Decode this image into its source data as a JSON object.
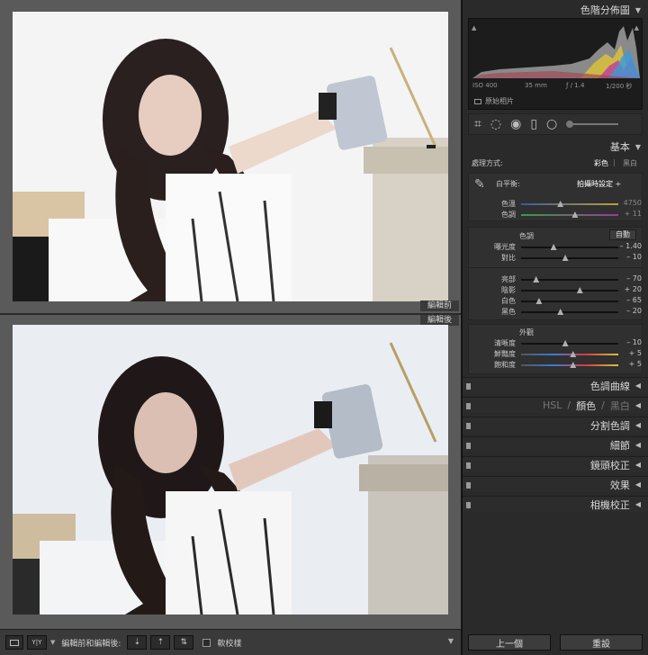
{
  "compare": {
    "before_label": "編輯前",
    "after_label": "編輯後"
  },
  "toolbar": {
    "compare_mode_label": "編輯前和編輯後:",
    "soft_proof_label": "軟校樣",
    "view_icon_label": "Y|Y"
  },
  "histogram": {
    "title": "色階分佈圖",
    "iso": "ISO 400",
    "focal": "35 mm",
    "aperture": "ƒ / 1.4",
    "shutter": "1/200 秒",
    "original_photo_label": "原始相片"
  },
  "basic": {
    "title": "基本",
    "treatment_label": "處理方式:",
    "treatment_color": "彩色",
    "treatment_bw": "黑白",
    "wb_label": "白平衡:",
    "wb_value": "拍攝時設定 ÷",
    "temp": {
      "label": "色溫",
      "value": "4750",
      "pos": 0.4
    },
    "tint": {
      "label": "色調",
      "value": "+ 11",
      "pos": 0.55
    },
    "tone_title": "色調",
    "auto_label": "自動",
    "exposure": {
      "label": "曝光度",
      "value": "– 1.40",
      "pos": 0.33
    },
    "contrast": {
      "label": "對比",
      "value": "– 10",
      "pos": 0.45
    },
    "highlights": {
      "label": "亮部",
      "value": "– 70",
      "pos": 0.15
    },
    "shadows": {
      "label": "陰影",
      "value": "+ 20",
      "pos": 0.6
    },
    "whites": {
      "label": "白色",
      "value": "– 65",
      "pos": 0.18
    },
    "blacks": {
      "label": "黑色",
      "value": "– 20",
      "pos": 0.4
    },
    "presence_title": "外觀",
    "clarity": {
      "label": "清晰度",
      "value": "– 10",
      "pos": 0.45
    },
    "vibrance": {
      "label": "鮮豔度",
      "value": "+ 5",
      "pos": 0.53
    },
    "saturation": {
      "label": "飽和度",
      "value": "+ 5",
      "pos": 0.53
    }
  },
  "panels": {
    "tone_curve": "色調曲線",
    "hsl": "HSL",
    "hsl_color": "顏色",
    "hsl_bw": "黑白",
    "sep": "/",
    "split_toning": "分割色調",
    "detail": "細節",
    "lens": "鏡頭校正",
    "effects": "效果",
    "camera": "相機校正"
  },
  "nav": {
    "prev": "上一個",
    "reset": "重設"
  },
  "colors": {
    "panel_bg": "#2a2a2a",
    "compare_bg": "#5a5a5a"
  }
}
